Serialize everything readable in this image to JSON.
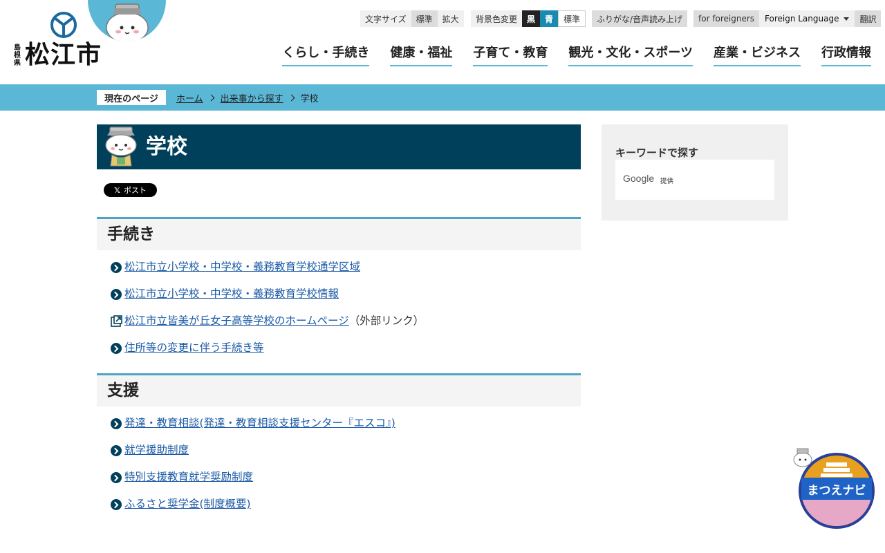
{
  "header": {
    "logo": {
      "prefecture": "島根県",
      "city": "松江市"
    },
    "util": {
      "text_size_label": "文字サイズ",
      "text_size_standard": "標準",
      "text_size_large": "拡大",
      "bg_color_label": "背景色変更",
      "bg_black": "黒",
      "bg_blue": "青",
      "bg_standard": "標準",
      "furigana": "ふりがな/音声読み上げ",
      "foreigners": "for foreigners",
      "foreign_language": "Foreign Language",
      "translate": "翻訳"
    },
    "nav": [
      {
        "label": "くらし・手続き"
      },
      {
        "label": "健康・福祉"
      },
      {
        "label": "子育て・教育"
      },
      {
        "label": "観光・文化・スポーツ"
      },
      {
        "label": "産業・ビジネス"
      },
      {
        "label": "行政情報"
      }
    ]
  },
  "breadcrumb": {
    "current_label": "現在のページ",
    "items": [
      "ホーム",
      "出来事から探す"
    ],
    "current": "学校"
  },
  "main": {
    "title": "学校",
    "share_post": "ポスト",
    "sections": [
      {
        "heading": "手続き",
        "links": [
          {
            "label": "松江市立小学校・中学校・義務教育学校通学区域",
            "icon": "arrow-circle-icon"
          },
          {
            "label": "松江市立小学校・中学校・義務教育学校情報",
            "icon": "arrow-circle-icon"
          },
          {
            "label": "松江市立皆美が丘女子高等学校のホームページ",
            "icon": "external-link-icon",
            "note": "（外部リンク）"
          },
          {
            "label": "住所等の変更に伴う手続き等",
            "icon": "arrow-circle-icon"
          }
        ]
      },
      {
        "heading": "支援",
        "links": [
          {
            "label": "発達・教育相談(発達・教育相談支援センター『エスコ』)",
            "icon": "arrow-circle-icon"
          },
          {
            "label": "就学援助制度",
            "icon": "arrow-circle-icon"
          },
          {
            "label": "特別支援教育就学奨励制度",
            "icon": "arrow-circle-icon"
          },
          {
            "label": "ふるさと奨学金(制度概要)",
            "icon": "arrow-circle-icon"
          }
        ]
      }
    ]
  },
  "sidebar": {
    "keyword_heading": "キーワードで探す",
    "google_label": "Google",
    "provided": "提供"
  },
  "floating": {
    "navi_label": "まつえナビ"
  },
  "colors": {
    "accent": "#5bb7d6",
    "title_bg": "#00405a",
    "link": "#1a5aa6",
    "bg_blue_button": "#1a8bb0"
  }
}
